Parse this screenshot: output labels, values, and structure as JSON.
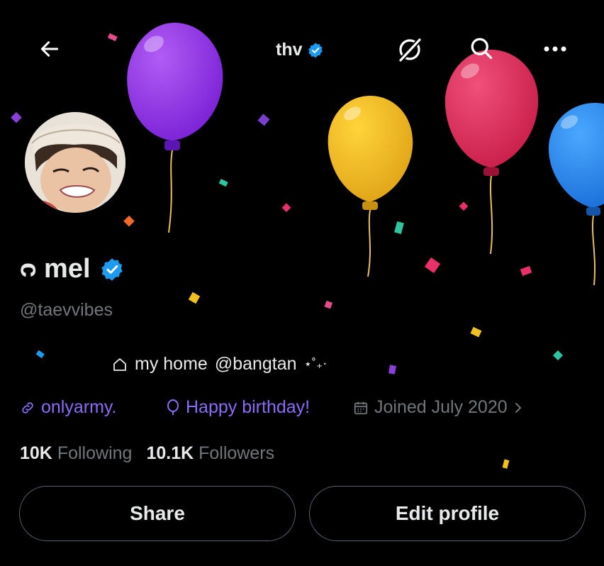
{
  "header": {
    "title": "thv",
    "back_icon": "arrow-left-icon",
    "grok_icon": "grok-slash-icon",
    "search_icon": "search-icon",
    "more_icon": "more-dots-icon"
  },
  "profile": {
    "display_name": "ᴒ mel",
    "handle": "@taevvibes",
    "verified": true,
    "bio": {
      "icon": "house-icon",
      "text1": "my home",
      "mention": "@bangtan",
      "sparkle": "⋆˚₊⋅"
    },
    "link": "onlyarmy.",
    "birthday": "Happy birthday!",
    "joined": "Joined July 2020",
    "following_count": "10K",
    "following_label": "Following",
    "followers_count": "10.1K",
    "followers_label": "Followers"
  },
  "buttons": {
    "share": "Share",
    "edit_profile": "Edit profile"
  },
  "colors": {
    "accent_link": "#8b6cf3",
    "verified_blue": "#1d9bf0",
    "muted": "#71767b"
  }
}
